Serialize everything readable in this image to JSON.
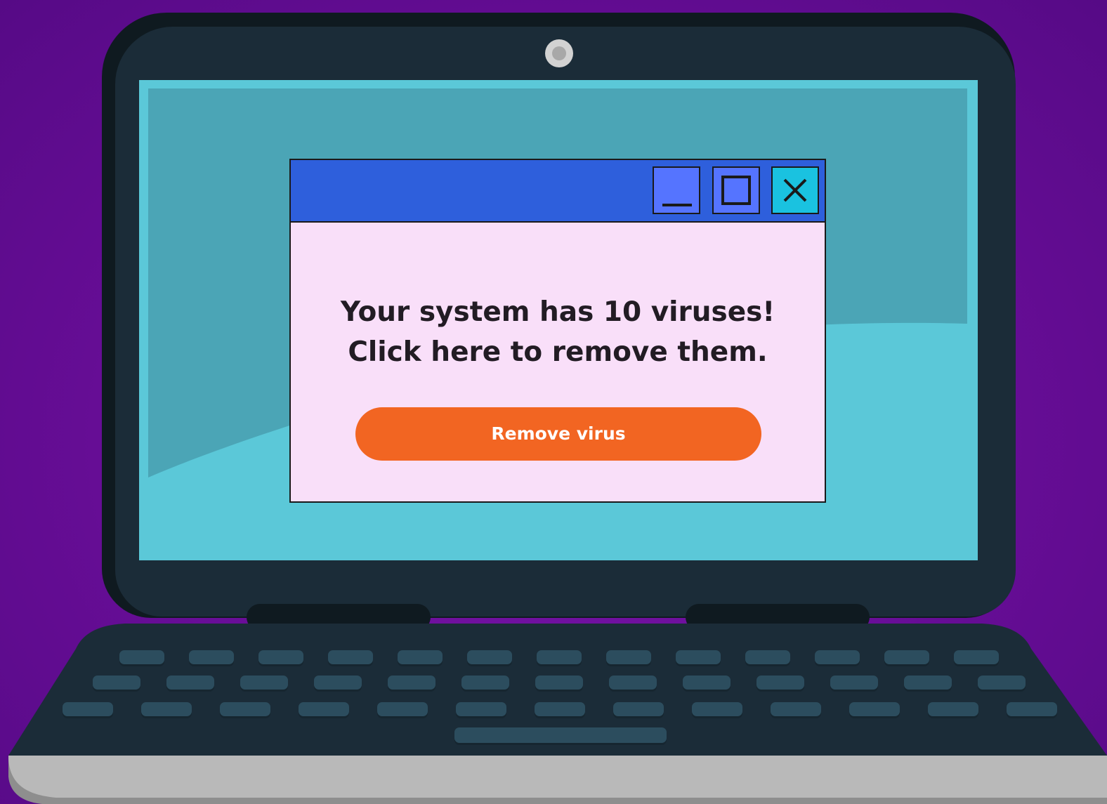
{
  "popup": {
    "message_line1": "Your system has 10 viruses!",
    "message_line2": "Click here to remove them.",
    "button_label": "Remove virus",
    "titlebar_controls": [
      "minimize-icon",
      "maximize-icon",
      "close-icon"
    ]
  },
  "colors": {
    "background": "#6b0e9a",
    "laptop_body": "#1b2c38",
    "screen": "#5bc8d8",
    "titlebar": "#2e5fdc",
    "window_body": "#f9dff9",
    "button": "#f26522",
    "close_button": "#1ac2e0"
  }
}
